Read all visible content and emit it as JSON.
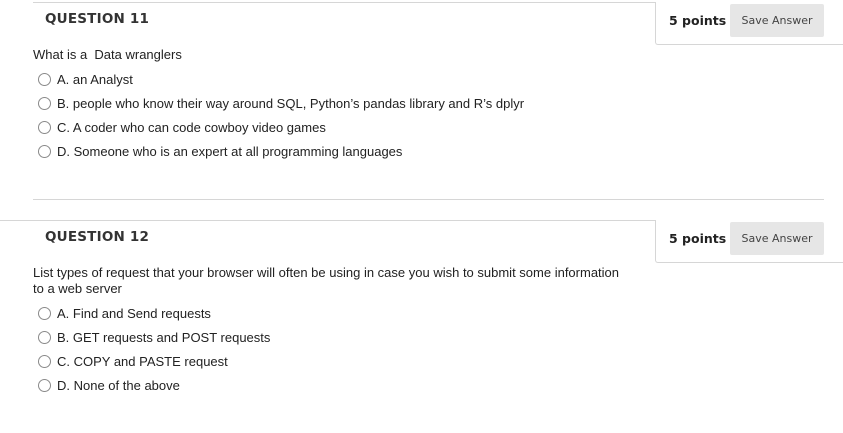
{
  "questions": [
    {
      "title": "QUESTION 11",
      "points": "5 points",
      "save_label": "Save Answer",
      "prompt": "What is a  Data wranglers",
      "options": [
        "A. an Analyst",
        "B. people who know their way around SQL, Python’s pandas library and R’s dplyr",
        "C. A coder who can code cowboy video games",
        "D. Someone who is an expert at all programming languages"
      ]
    },
    {
      "title": "QUESTION 12",
      "points": "5 points",
      "save_label": "Save Answer",
      "prompt_line1": "List types of request that your browser will often be using in case you wish to submit some information",
      "prompt_line2": "to a web server",
      "options": [
        "A. Find and Send requests",
        "B. GET requests and POST requests",
        "C. COPY and PASTE request",
        "D. None of the above"
      ]
    }
  ]
}
